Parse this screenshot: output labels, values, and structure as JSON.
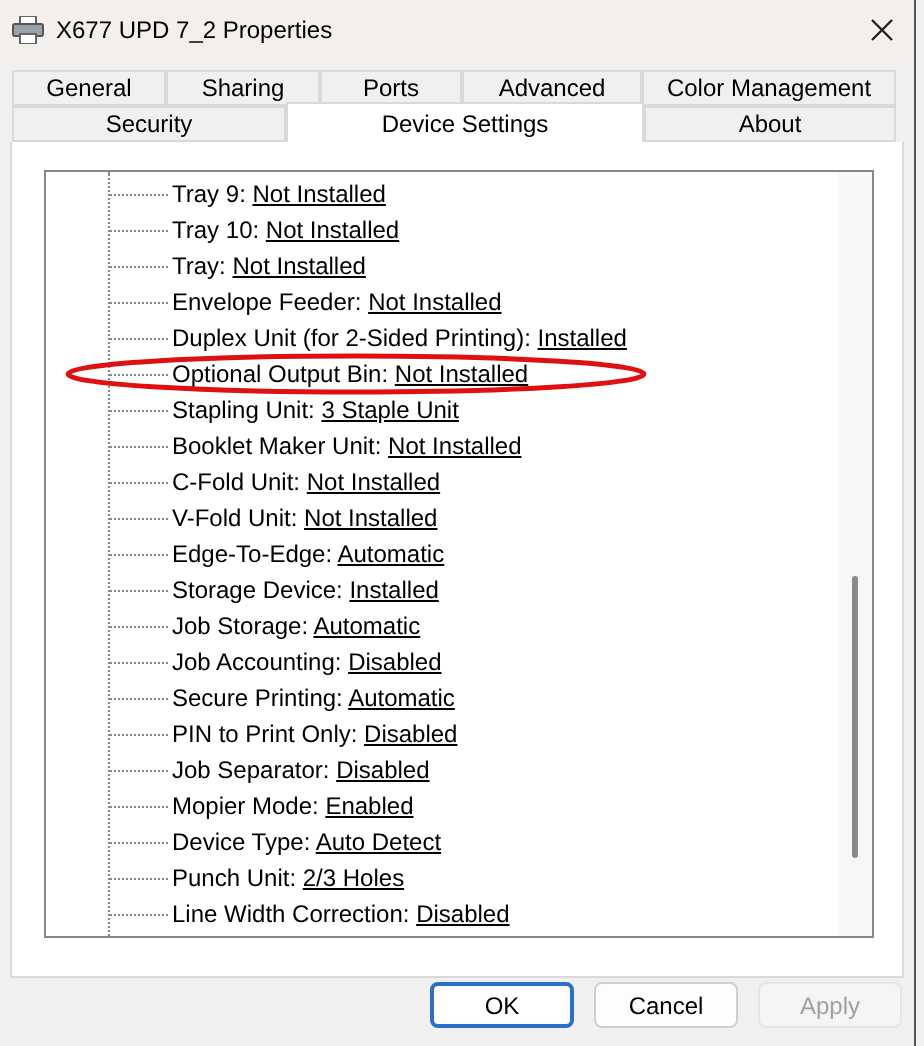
{
  "window": {
    "title": "X677 UPD 7_2 Properties"
  },
  "tab_rows": [
    {
      "tabs": [
        {
          "label": "General",
          "selected": false
        },
        {
          "label": "Sharing",
          "selected": false
        },
        {
          "label": "Ports",
          "selected": false
        },
        {
          "label": "Advanced",
          "selected": false
        },
        {
          "label": "Color Management",
          "selected": false
        }
      ]
    },
    {
      "tabs": [
        {
          "label": "Security",
          "selected": false
        },
        {
          "label": "Device Settings",
          "selected": true
        },
        {
          "label": "About",
          "selected": false
        }
      ]
    }
  ],
  "tree": {
    "items": [
      {
        "label": "Tray 9:",
        "value": "Not Installed"
      },
      {
        "label": "Tray 10:",
        "value": "Not Installed"
      },
      {
        "label": "Tray:",
        "value": "Not Installed"
      },
      {
        "label": "Envelope Feeder:",
        "value": "Not Installed"
      },
      {
        "label": "Duplex Unit (for 2-Sided Printing):",
        "value": "Installed"
      },
      {
        "label": "Optional Output Bin:",
        "value": "Not Installed",
        "circled": true
      },
      {
        "label": "Stapling Unit:",
        "value": "3 Staple Unit"
      },
      {
        "label": "Booklet Maker Unit:",
        "value": "Not Installed"
      },
      {
        "label": "C-Fold Unit:",
        "value": "Not Installed"
      },
      {
        "label": "V-Fold Unit:",
        "value": "Not Installed"
      },
      {
        "label": "Edge-To-Edge:",
        "value": "Automatic"
      },
      {
        "label": "Storage Device:",
        "value": "Installed"
      },
      {
        "label": "Job Storage:",
        "value": "Automatic"
      },
      {
        "label": "Job Accounting:",
        "value": "Disabled"
      },
      {
        "label": "Secure Printing:",
        "value": "Automatic"
      },
      {
        "label": "PIN to Print Only:",
        "value": "Disabled"
      },
      {
        "label": "Job Separator:",
        "value": "Disabled"
      },
      {
        "label": "Mopier Mode:",
        "value": "Enabled"
      },
      {
        "label": "Device Type:",
        "value": "Auto Detect"
      },
      {
        "label": "Punch Unit:",
        "value": "2/3 Holes"
      },
      {
        "label": "Line Width Correction:",
        "value": "Disabled"
      }
    ]
  },
  "buttons": [
    {
      "label": "OK",
      "default": true,
      "disabled": false
    },
    {
      "label": "Cancel",
      "default": false,
      "disabled": false
    },
    {
      "label": "Apply",
      "default": false,
      "disabled": true
    }
  ]
}
